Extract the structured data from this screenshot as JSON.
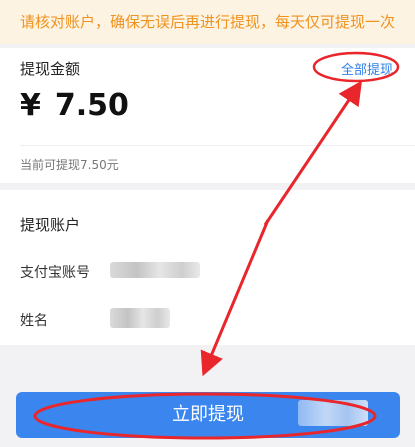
{
  "notice": {
    "text": "请核对账户，确保无误后再进行提现，每天仅可提现一次"
  },
  "amount_section": {
    "title": "提现金额",
    "withdraw_all_label": "全部提现",
    "currency_symbol": "¥",
    "amount": "7.50",
    "available_text": "当前可提现7.50元"
  },
  "account_section": {
    "title": "提现账户",
    "alipay_label": "支付宝账号",
    "name_label": "姓名"
  },
  "submit_button": {
    "label": "立即提现"
  },
  "colors": {
    "notice_bg": "#fdf3e2",
    "notice_text": "#f0921e",
    "link": "#2f7fe8",
    "primary_button": "#3a86ee",
    "annotation_red": "#e8262b"
  }
}
